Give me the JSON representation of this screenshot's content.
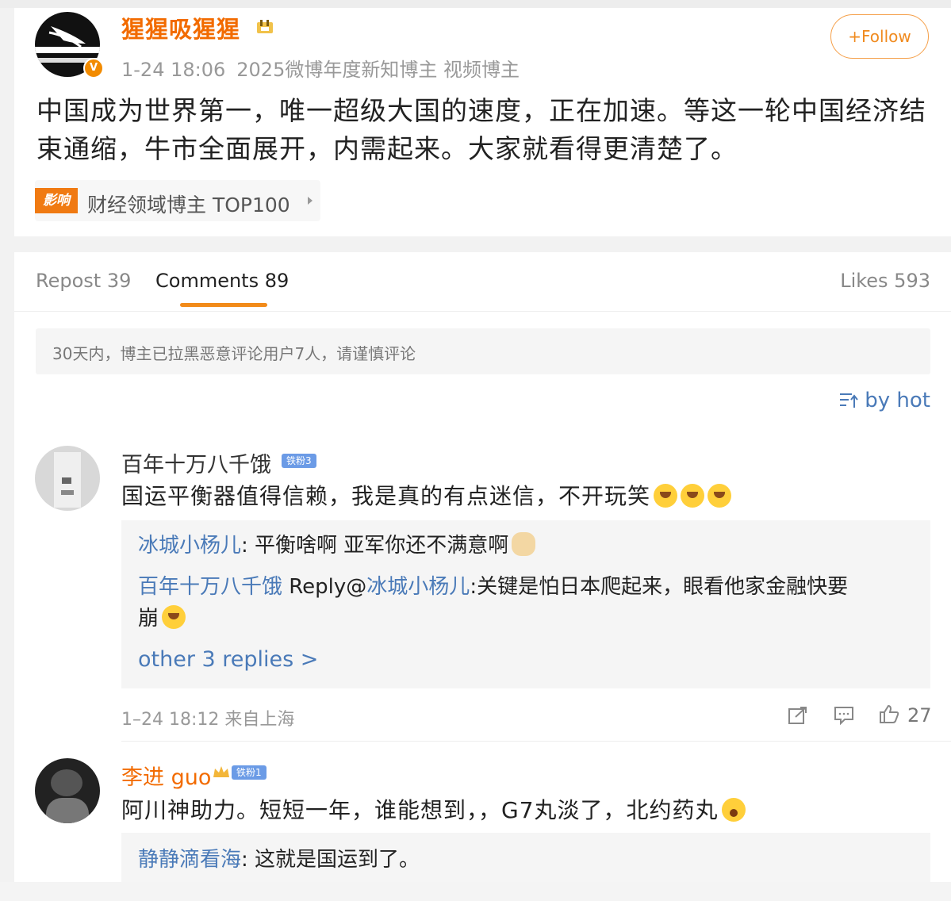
{
  "post": {
    "author": "猩猩吸猩猩",
    "verified_mark": "V",
    "time": "1-24 18:06",
    "tags": "2025微博年度新知博主 视频博主",
    "follow_label": "+Follow",
    "text": "中国成为世界第一，唯一超级大国的速度，正在加速。等这一轮中国经济结束通缩，牛市全面展开，内需起来。大家就看得更清楚了。",
    "influence_logo": "影响",
    "influence_text": "财经领域博主 TOP100"
  },
  "tabs": {
    "repost": "Repost 39",
    "comments": "Comments 89",
    "likes": "Likes 593"
  },
  "notice": "30天内，博主已拉黑恶意评论用户7人，请谨慎评论",
  "sort_label": "by hot",
  "comments": [
    {
      "name": "百年十万八千饿",
      "badge": "铁粉3",
      "text": "国运平衡器值得信赖，我是真的有点迷信，不开玩笑",
      "replies": [
        {
          "user": "冰城小杨儿",
          "sep": ": ",
          "text": "平衡啥啊 亚军你还不满意啊"
        },
        {
          "user": "百年十万八千饿",
          "mid": " Reply@",
          "target": "冰城小杨儿",
          "sep": ":",
          "text": "关键是怕日本爬起来，眼看他家金融快要",
          "text2": "崩"
        }
      ],
      "more_replies": "other 3 replies >",
      "time": "1–24 18:12 来自上海",
      "likes": "27"
    },
    {
      "name": "李进 guo",
      "badge": "铁粉1",
      "text": "阿川神助力。短短一年，谁能想到，，G7丸淡了，北约药丸",
      "replies": [
        {
          "user": "静静滴看海",
          "sep": ": ",
          "text": "这就是国运到了。"
        }
      ]
    }
  ],
  "colors": {
    "orange": "#f26b00",
    "link_blue": "#4a7ab8",
    "tab_underline": "#f28b1a"
  },
  "icons": [
    "gear-icon",
    "share-icon",
    "comment-icon",
    "like-icon",
    "sort-icon"
  ]
}
